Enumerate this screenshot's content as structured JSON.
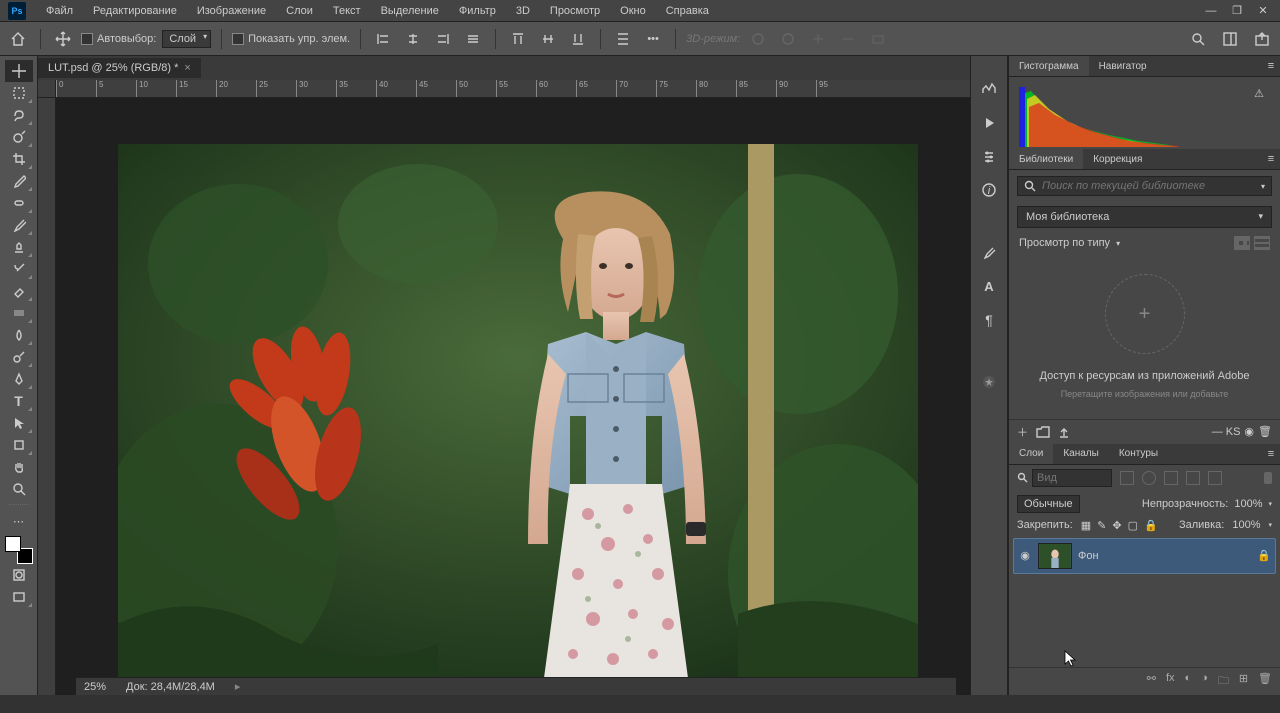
{
  "menu": [
    "Файл",
    "Редактирование",
    "Изображение",
    "Слои",
    "Текст",
    "Выделение",
    "Фильтр",
    "3D",
    "Просмотр",
    "Окно",
    "Справка"
  ],
  "options": {
    "auto_select": "Автовыбор:",
    "target": "Слой",
    "show_controls": "Показать упр. элем.",
    "mode_3d": "3D-режим:"
  },
  "doc_tab": "LUT.psd @ 25% (RGB/8) *",
  "ruler_h": [
    "0",
    "5",
    "10",
    "15",
    "20",
    "25",
    "30",
    "35",
    "40",
    "45",
    "50",
    "55",
    "60",
    "65",
    "70",
    "75",
    "80",
    "85",
    "90",
    "95"
  ],
  "zoom": "25%",
  "doc_size": "Док: 28,4M/28,4M",
  "panel_histogram": {
    "tab1": "Гистограмма",
    "tab2": "Навигатор"
  },
  "panel_libraries": {
    "tab1": "Библиотеки",
    "tab2": "Коррекция",
    "search_ph": "Поиск по текущей библиотеке",
    "select": "Моя библиотека",
    "view": "Просмотр по типу",
    "drop_title": "Доступ к ресурсам из приложений Adobe",
    "drop_sub": "Перетащите изображения или добавьте",
    "badge": "— KS"
  },
  "panel_layers": {
    "tab1": "Слои",
    "tab2": "Каналы",
    "tab3": "Контуры",
    "kind": "Вид",
    "blend": "Обычные",
    "opacity_lbl": "Непрозрачность:",
    "opacity_val": "100%",
    "lock_lbl": "Закрепить:",
    "fill_lbl": "Заливка:",
    "fill_val": "100%",
    "layer_name": "Фон"
  }
}
